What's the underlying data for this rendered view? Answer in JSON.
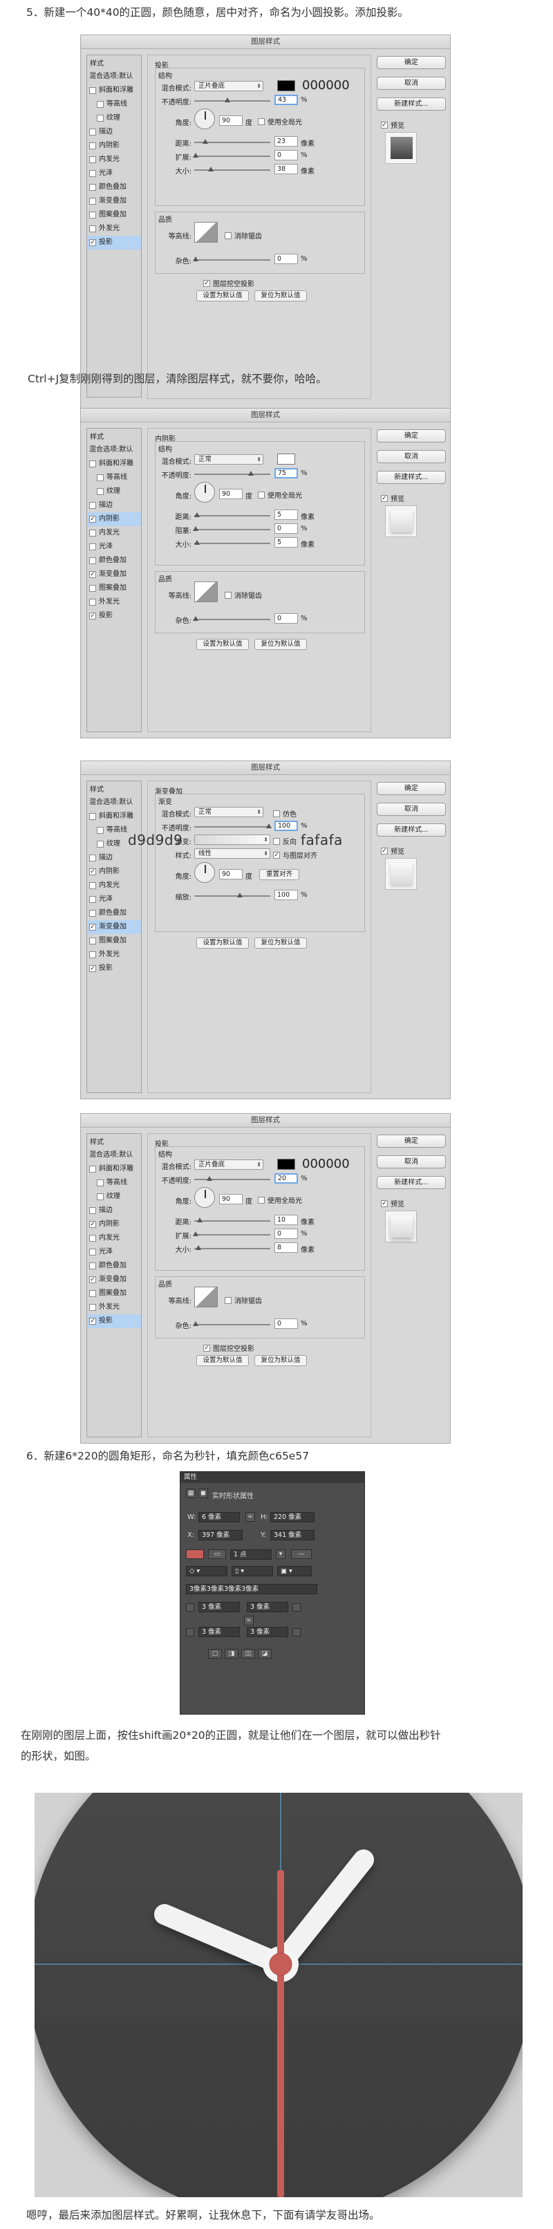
{
  "paras": {
    "p1": "5．新建一个40*40的正圆，颜色随意，居中对齐，命名为小圆投影。添加投影。",
    "p2": "Ctrl+J复制刚刚得到的图层，清除图层样式，就不要你，哈哈。",
    "p3": "6．新建6*220的圆角矩形，命名为秒针，填充颜色c65e57",
    "p4a": "在刚刚的图层上面，按住shift画20*20的正圆，就是让他们在一个图层，就可以做出秒针",
    "p4b": "的形状，如图。",
    "p5": "嗯哼，最后来添加图层样式。好累啊，让我休息下，下面有请学友哥出场。"
  },
  "common": {
    "title": "图层样式",
    "styles_header": "样式",
    "items": [
      "混合选项:默认",
      "斜面和浮雕",
      "等高线",
      "纹理",
      "描边",
      "内阴影",
      "内发光",
      "光泽",
      "颜色叠加",
      "渐变叠加",
      "图案叠加",
      "外发光",
      "投影"
    ],
    "ok": "确定",
    "cancel": "取消",
    "new_style": "新建样式...",
    "preview": "预览",
    "structure": "结构",
    "quality": "品质",
    "blend_mode": "混合模式:",
    "opacity": "不透明度:",
    "angle": "角度:",
    "use_global": "使用全局光",
    "distance": "距离:",
    "spread": "扩展:",
    "choke": "阻塞:",
    "size": "大小:",
    "contour": "等高线:",
    "antialias": "消除锯齿",
    "noise": "杂色:",
    "knockout": "图层挖空投影",
    "make_default": "设置为默认值",
    "reset_default": "复位为默认值",
    "px": "像素",
    "deg": "度",
    "pct": "%"
  },
  "w1": {
    "section": "投影",
    "blend": "正片叠底",
    "color_hex": "000000",
    "color": "#000000",
    "opacity": "43",
    "angle": "90",
    "distance": "23",
    "spread": "0",
    "size": "38",
    "noise": "0"
  },
  "w2": {
    "section": "内阴影",
    "blend": "正常",
    "color": "#ffffff",
    "opacity": "75",
    "angle": "90",
    "distance": "5",
    "choke": "0",
    "size": "5",
    "noise": "0"
  },
  "w3": {
    "section": "渐变叠加",
    "sub": "渐变",
    "blend": "正常",
    "dither": "仿色",
    "opacity": "100",
    "gradient_label": "渐变:",
    "reverse": "反向",
    "style_label": "样式:",
    "style": "线性",
    "align": "与图层对齐",
    "angle": "90",
    "reset_align": "重置对齐",
    "scale_label": "缩放:",
    "scale": "100",
    "left_color": "d9d9d9",
    "right_color": "fafafa"
  },
  "w4": {
    "section": "投影",
    "blend": "正片叠底",
    "color_hex": "000000",
    "color": "#000000",
    "opacity": "20",
    "angle": "90",
    "distance": "10",
    "spread": "0",
    "size": "8",
    "noise": "0"
  },
  "props": {
    "header": "属性",
    "title": "实时形状属性",
    "w_label": "W:",
    "w": "6 像素",
    "h_label": "H:",
    "h": "220 像素",
    "x_label": "X:",
    "x": "397 像素",
    "y_label": "Y:",
    "y": "341 像素",
    "stroke": "1 点",
    "radii": "3像素3像素3像素3像素",
    "r1": "3 像素",
    "r2": "3 像素",
    "r3": "3 像素",
    "r4": "3 像素",
    "fill": "#c65e57"
  }
}
